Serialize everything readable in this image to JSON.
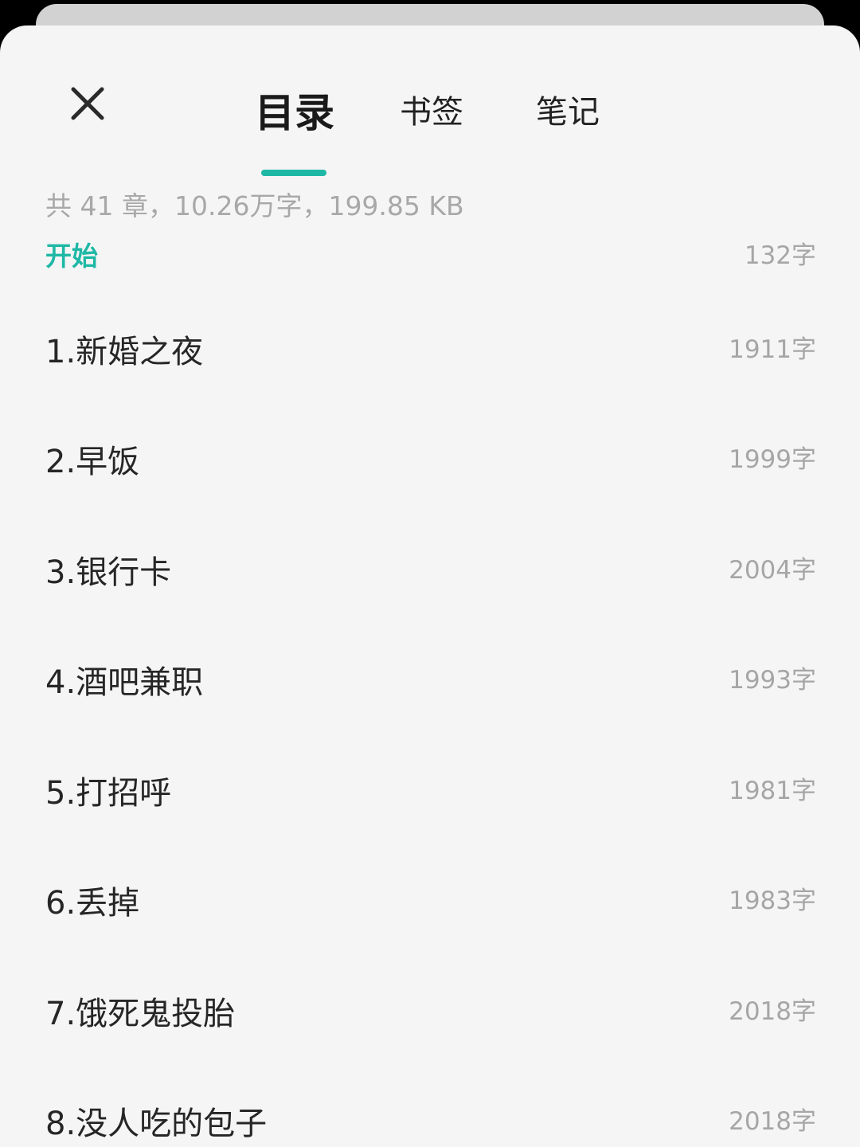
{
  "tabs": {
    "catalog": "目录",
    "bookmark": "书签",
    "notes": "笔记",
    "active": "catalog"
  },
  "summary": "共 41 章，10.26万字，199.85 KB",
  "accent_color": "#1fb8a6",
  "icons": {
    "close": "close-icon"
  },
  "chapters": [
    {
      "title": "开始",
      "count": "132字",
      "current": true
    },
    {
      "title": "1.新婚之夜",
      "count": "1911字",
      "current": false
    },
    {
      "title": "2.早饭",
      "count": "1999字",
      "current": false
    },
    {
      "title": "3.银行卡",
      "count": "2004字",
      "current": false
    },
    {
      "title": "4.酒吧兼职",
      "count": "1993字",
      "current": false
    },
    {
      "title": "5.打招呼",
      "count": "1981字",
      "current": false
    },
    {
      "title": "6.丢掉",
      "count": "1983字",
      "current": false
    },
    {
      "title": "7.饿死鬼投胎",
      "count": "2018字",
      "current": false
    },
    {
      "title": "8.没人吃的包子",
      "count": "2018字",
      "current": false
    }
  ]
}
